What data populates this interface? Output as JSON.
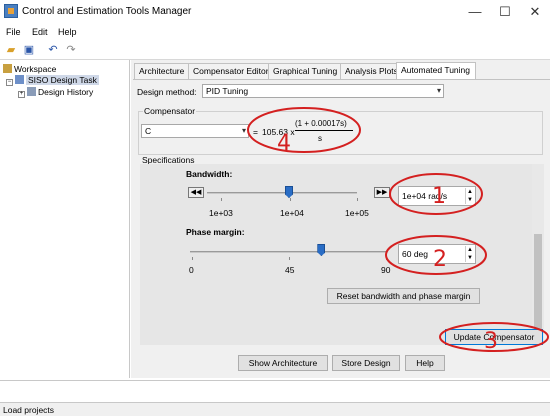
{
  "window": {
    "title": "Control and Estimation Tools Manager",
    "minimize": "—",
    "maximize": "☐",
    "close": "✕"
  },
  "menu": [
    "File",
    "Edit",
    "Help"
  ],
  "toolbar": [
    {
      "icon": "open-folder-icon",
      "glyph": "📂"
    },
    {
      "icon": "save-icon",
      "glyph": "💾"
    },
    {
      "icon": "undo-icon",
      "glyph": "↶"
    },
    {
      "icon": "redo-icon",
      "glyph": "↷"
    }
  ],
  "tree": {
    "root": "Workspace",
    "task": "SISO Design Task",
    "child": "Design History"
  },
  "tabs": [
    "Architecture",
    "Compensator Editor",
    "Graphical Tuning",
    "Analysis Plots",
    "Automated Tuning"
  ],
  "active_tab": "Automated Tuning",
  "design_method": {
    "label": "Design method:",
    "value": "PID Tuning"
  },
  "compensator": {
    "group_label": "Compensator",
    "select_value": "C",
    "equals": "=",
    "gain": "105.63 x",
    "numerator": "(1 + 0.00017s)",
    "denominator": "s"
  },
  "specifications": {
    "group_label": "Specifications",
    "bandwidth": {
      "label": "Bandwidth:",
      "ticks": [
        "1e+03",
        "1e+04",
        "1e+05"
      ],
      "value": "1e+04 rad/s",
      "left_arrow": "◀◀",
      "right_arrow": "▶▶",
      "slider_fraction": 0.5
    },
    "phase_margin": {
      "label": "Phase margin:",
      "ticks": [
        "0",
        "45",
        "90"
      ],
      "value": "60 deg",
      "slider_fraction": 0.667
    },
    "reset_button": "Reset bandwidth and phase margin"
  },
  "update_button": "Update Compensator",
  "bottom_buttons": [
    "Show Architecture",
    "Store Design",
    "Help"
  ],
  "status": "Load projects",
  "annotations": [
    {
      "label": "1",
      "color": "#d42020"
    },
    {
      "label": "2",
      "color": "#d42020"
    },
    {
      "label": "3",
      "color": "#d42020"
    },
    {
      "label": "4",
      "color": "#d42020"
    }
  ]
}
